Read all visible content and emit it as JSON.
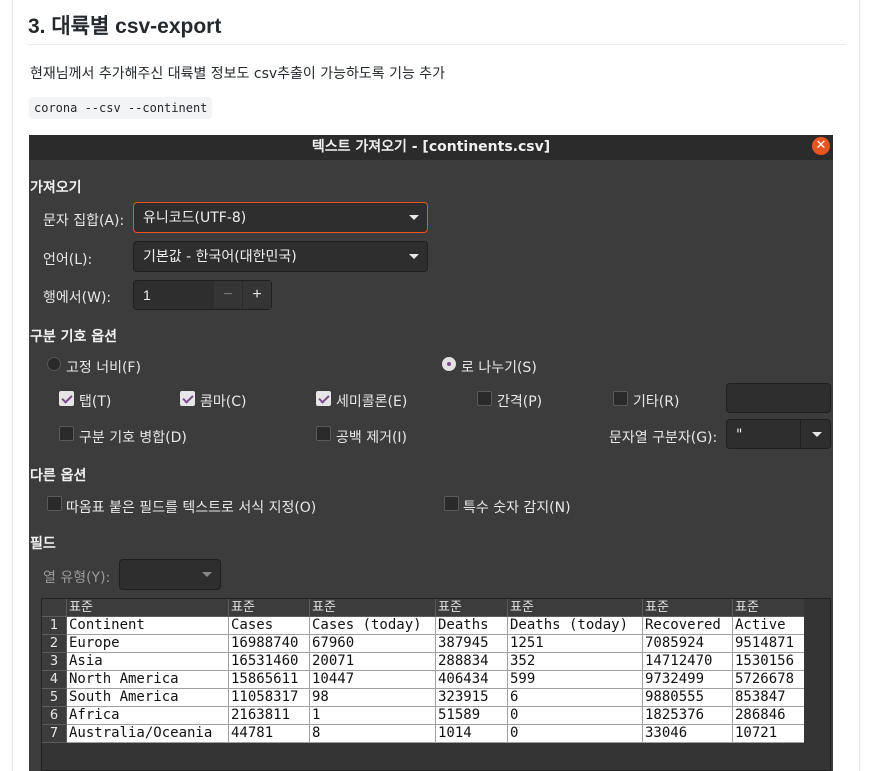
{
  "doc": {
    "heading": "3. 대륙별 csv-export",
    "paragraph": "현재님께서 추가해주신 대륙별 정보도 csv추출이 가능하도록 기능 추가",
    "code": "corona --csv --continent"
  },
  "dialog": {
    "title": "텍스트 가져오기 - [continents.csv]",
    "close_icon": "close-icon",
    "import_section": "가져오기",
    "charset_label": "문자 집합(A):",
    "charset_value": "유니코드(UTF-8)",
    "language_label": "언어(L):",
    "language_value": "기본값 - 한국어(대한민국)",
    "from_row_label": "행에서(W):",
    "from_row_value": "1",
    "minus": "−",
    "plus": "+",
    "separator_section": "구분 기호 옵션",
    "fixed_width": "고정 너비(F)",
    "separated_by": "로 나누기(S)",
    "tab": "탭(T)",
    "comma": "콤마(C)",
    "semicolon": "세미콜론(E)",
    "space": "간격(P)",
    "other": "기타(R)",
    "merge_delimiters": "구분 기호 병합(D)",
    "trim_spaces": "공백 제거(I)",
    "string_delimiter_label": "문자열 구분자(G):",
    "string_delimiter_value": "\"",
    "other_section": "다른 옵션",
    "quoted_as_text": "따옴표 붙은 필드를 텍스트로 서식 지정(O)",
    "detect_special_numbers": "특수 숫자 감지(N)",
    "fields_section": "필드",
    "column_type_label": "열 유형(Y):",
    "column_type_value": ""
  },
  "table": {
    "header_label": "표준",
    "rows": [
      [
        "1",
        "Continent",
        "Cases",
        "Cases (today)",
        "Deaths",
        "Deaths (today)",
        "Recovered",
        "Active"
      ],
      [
        "2",
        "Europe",
        "16988740",
        "67960",
        "387945",
        "1251",
        "7085924",
        "9514871"
      ],
      [
        "3",
        "Asia",
        "16531460",
        "20071",
        "288834",
        "352",
        "14712470",
        "1530156"
      ],
      [
        "4",
        "North America",
        "15865611",
        "10447",
        "406434",
        "599",
        "9732499",
        "5726678"
      ],
      [
        "5",
        "South America",
        "11058317",
        "98",
        "323915",
        "6",
        "9880555",
        "853847"
      ],
      [
        "6",
        "Africa",
        "2163811",
        "1",
        "51589",
        "0",
        "1825376",
        "286846"
      ],
      [
        "7",
        "Australia/Oceania",
        "44781",
        "8",
        "1014",
        "0",
        "33046",
        "10721"
      ]
    ]
  }
}
